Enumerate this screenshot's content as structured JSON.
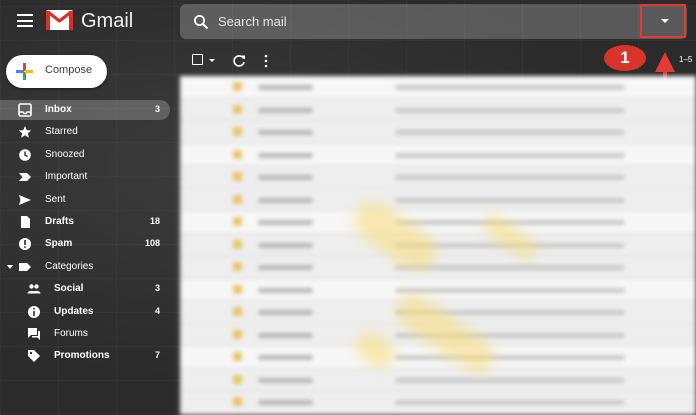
{
  "header": {
    "app_name": "Gmail",
    "search": {
      "placeholder": "Search mail",
      "value": ""
    },
    "icons": [
      "menu-icon",
      "gmail-logo",
      "search-icon",
      "search-options-caret-icon"
    ]
  },
  "annotation": {
    "step_label": "1",
    "color": "#d9342b"
  },
  "compose": {
    "label": "Compose"
  },
  "sidebar": {
    "items": [
      {
        "name": "inbox",
        "label": "Inbox",
        "count": "3",
        "icon": "inbox-icon",
        "bold": true,
        "active": true
      },
      {
        "name": "starred",
        "label": "Starred",
        "count": "",
        "icon": "star-icon",
        "bold": false
      },
      {
        "name": "snoozed",
        "label": "Snoozed",
        "count": "",
        "icon": "clock-icon",
        "bold": false
      },
      {
        "name": "important",
        "label": "Important",
        "count": "",
        "icon": "important-icon",
        "bold": false
      },
      {
        "name": "sent",
        "label": "Sent",
        "count": "",
        "icon": "send-icon",
        "bold": false
      },
      {
        "name": "drafts",
        "label": "Drafts",
        "count": "18",
        "icon": "draft-icon",
        "bold": true
      },
      {
        "name": "spam",
        "label": "Spam",
        "count": "108",
        "icon": "spam-icon",
        "bold": true
      },
      {
        "name": "categories",
        "label": "Categories",
        "count": "",
        "icon": "label-icon",
        "bold": false
      },
      {
        "name": "social",
        "label": "Social",
        "count": "3",
        "icon": "people-icon",
        "bold": true,
        "sub": true
      },
      {
        "name": "updates",
        "label": "Updates",
        "count": "4",
        "icon": "info-icon",
        "bold": true,
        "sub": true
      },
      {
        "name": "forums",
        "label": "Forums",
        "count": "",
        "icon": "forum-icon",
        "bold": false,
        "sub": true
      },
      {
        "name": "promotions",
        "label": "Promotions",
        "count": "7",
        "icon": "tag-icon",
        "bold": true,
        "sub": true
      }
    ]
  },
  "toolbar": {
    "pager": "1–5"
  }
}
